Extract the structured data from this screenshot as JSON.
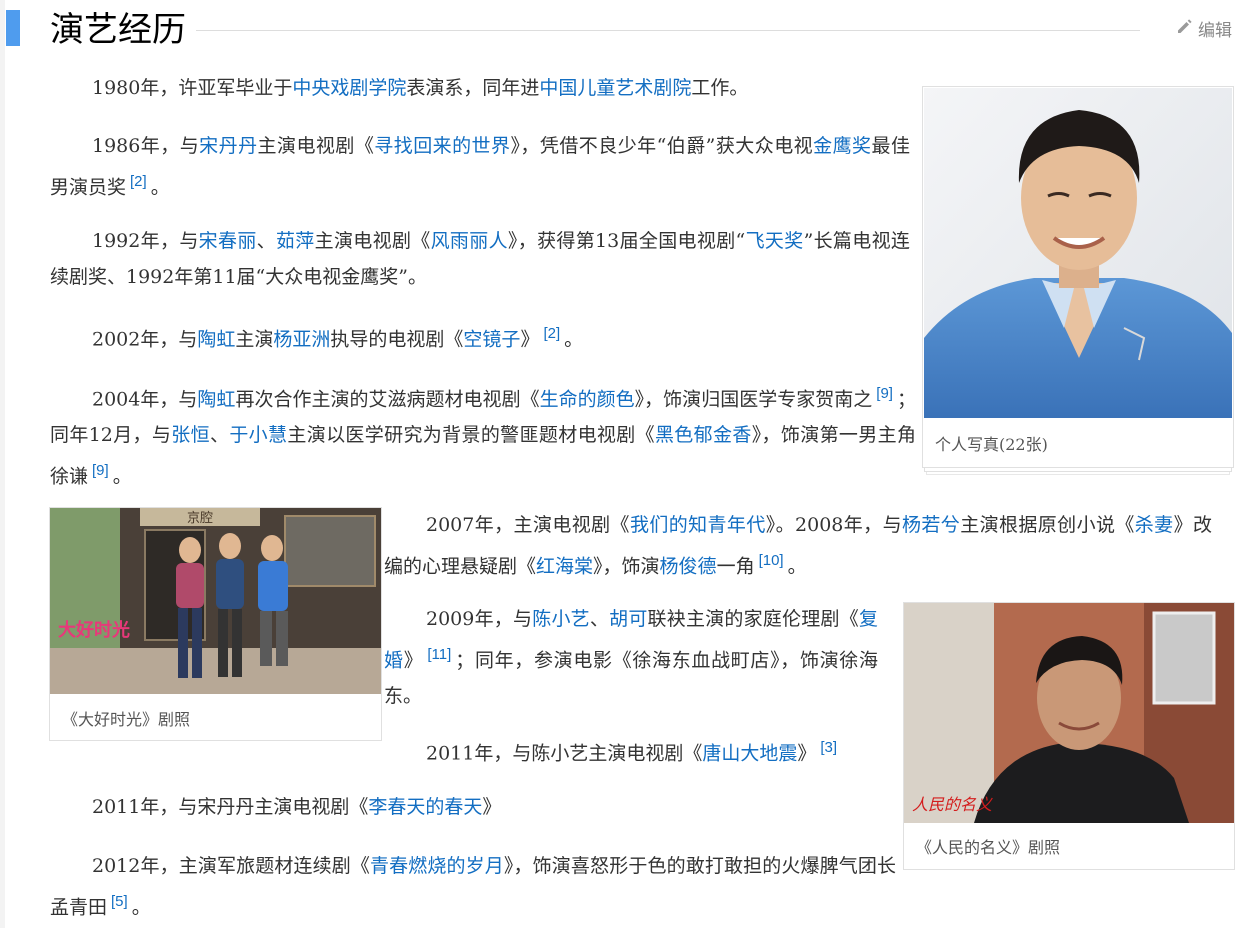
{
  "section": {
    "title": "演艺经历",
    "edit_label": "编辑"
  },
  "paras": {
    "p1": {
      "t1": "1980年，许亚军毕业于",
      "l1": "中央戏剧学院",
      "t2": "表演系，同年进",
      "l2": "中国儿童艺术剧院",
      "t3": "工作。"
    },
    "p2": {
      "t1": "1986年，与",
      "l1": "宋丹丹",
      "t2": "主演电视剧《",
      "l2": "寻找回来的世界",
      "t3": "》，凭借不良少年“伯爵”获大众电视",
      "l3": "金鹰奖",
      "t4": "最佳男演员奖",
      "r1": "[2]",
      "t5": "。"
    },
    "p3": {
      "t1": "1992年，与",
      "l1": "宋春丽",
      "t2": "、",
      "l2": "茹萍",
      "t3": "主演电视剧《",
      "l3": "风雨丽人",
      "t4": "》，获得第13届全国电视剧“",
      "l4": "飞天奖",
      "t5": "”长篇电视连续剧奖、1992年第11届“大众电视金鹰奖”。"
    },
    "p4": {
      "t1": "2002年，与",
      "l1": "陶虹",
      "t2": "主演",
      "l2": "杨亚洲",
      "t3": "执导的电视剧《",
      "l3": "空镜子",
      "t4": "》",
      "r1": "[2]",
      "t5": "。"
    },
    "p5": {
      "t1": "2004年，与",
      "l1": "陶虹",
      "t2": "再次合作主演的艾滋病题材电视剧《",
      "l2": "生命的颜色",
      "t3": "》，饰演归国医学专家贺南之",
      "r1": "[9]",
      "t4": "；同年12月，与",
      "l3": "张恒",
      "t5": "、",
      "l4": "于小慧",
      "t6": "主演以医学研究为背景的警匪题材电视剧《",
      "l5": "黑色郁金香",
      "t7": "》，饰演第一男主角徐谦",
      "r2": "[9]",
      "t8": "。"
    },
    "p6": {
      "t1": "2007年，主演电视剧《",
      "l1": "我们的知青年代",
      "t2": "》。2008年，与",
      "l2": "杨若兮",
      "t3": "主演根据原创小说《",
      "l3": "杀妻",
      "t4": "》改编的心理悬疑剧《",
      "l4": "红海棠",
      "t5": "》，饰演",
      "l5": "杨俊德",
      "t6": "一角",
      "r1": "[10]",
      "t7": "。"
    },
    "p7": {
      "t1": "2009年，与",
      "l1": "陈小艺",
      "t2": "、",
      "l2": "胡可",
      "t3": "联袂主演的家庭伦理剧《",
      "l3": "复婚",
      "t4": "》",
      "r1": "[11]",
      "t5": "；同年，参演电影《徐海东血战町店》，饰演徐海东。"
    },
    "p8": {
      "t1": "2011年，与陈小艺主演电视剧《",
      "l1": "唐山大地震",
      "t2": "》",
      "r1": "[3]"
    },
    "p9": {
      "t1": "2011年，与宋丹丹主演电视剧《",
      "l1": "李春天的春天",
      "t2": "》"
    },
    "p10": {
      "t1": "2012年，主演军旅题材连续剧《",
      "l1": "青春燃烧的岁月",
      "t2": "》，饰演喜怒形于色的敢打敢担的火爆脾气团长孟青田",
      "r1": "[5]",
      "t3": "。"
    }
  },
  "figures": {
    "portrait": {
      "caption": "个人写真(22张)"
    },
    "still1": {
      "caption": "《大好时光》剧照",
      "logo_text": "大好时光",
      "sign_text": "京腔"
    },
    "still2": {
      "caption": "《人民的名义》剧照",
      "logo_text": "人民的名义"
    }
  },
  "colors": {
    "link": "#136ec2",
    "accent": "#4f9cee",
    "text": "#333333"
  },
  "icons": {
    "edit": "pencil-icon"
  }
}
